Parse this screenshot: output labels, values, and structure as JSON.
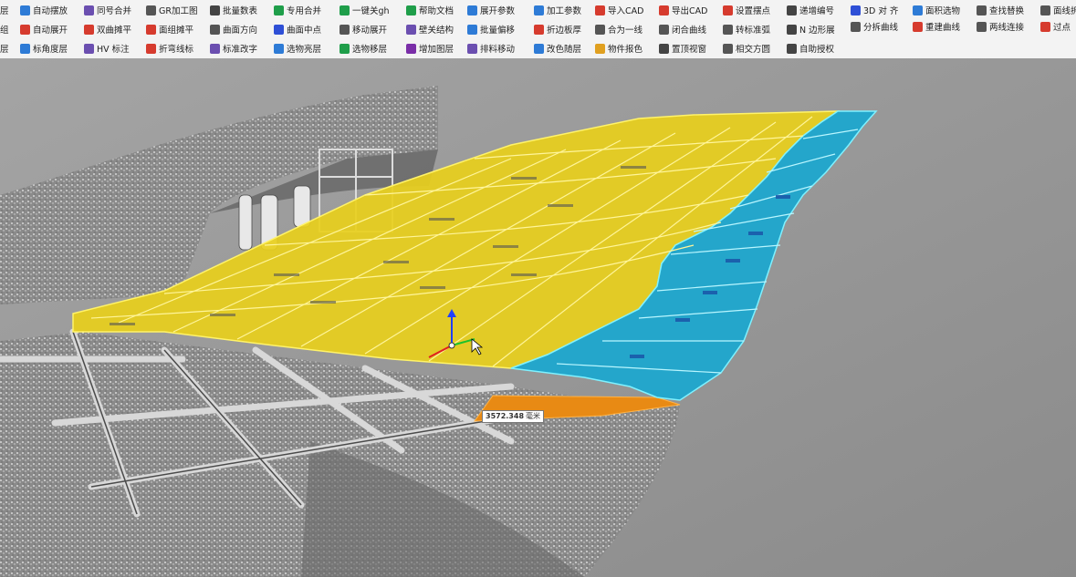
{
  "ribbon": {
    "columns": [
      {
        "items": [
          {
            "label": "自动摆放",
            "icon": "auto-place-icon",
            "color": "#2e7bd6"
          },
          {
            "label": "自动展开",
            "icon": "auto-unfold-icon",
            "color": "#d63b2e"
          },
          {
            "label": "标角度层",
            "icon": "angle-layer-icon",
            "color": "#2e7bd6"
          }
        ]
      },
      {
        "items": [
          {
            "label": "同号合并",
            "icon": "same-number-merge-icon",
            "color": "#6b4fb0"
          },
          {
            "label": "双曲摊平",
            "icon": "hyperbolic-flatten-icon",
            "color": "#d63b2e"
          },
          {
            "label": "HV 标注",
            "icon": "hv-annotate-icon",
            "color": "#6b4fb0"
          }
        ]
      },
      {
        "items": [
          {
            "label": "GR加工图",
            "icon": "gr-drawing-icon",
            "color": "#555555"
          },
          {
            "label": "面组摊平",
            "icon": "face-group-flatten-icon",
            "color": "#d63b2e"
          },
          {
            "label": "折弯线标",
            "icon": "bend-line-icon",
            "color": "#d63b2e"
          }
        ]
      },
      {
        "items": [
          {
            "label": "批量数表",
            "icon": "batch-table-icon",
            "color": "#444444"
          },
          {
            "label": "曲面方向",
            "icon": "surface-direction-icon",
            "color": "#555555"
          },
          {
            "label": "标准改字",
            "icon": "standard-text-icon",
            "color": "#6b4fb0"
          }
        ]
      },
      {
        "items": [
          {
            "label": "专用合并",
            "icon": "special-merge-icon",
            "color": "#1f9e4a"
          },
          {
            "label": "曲面中点",
            "icon": "surface-midpoint-icon",
            "color": "#2e4fd6"
          },
          {
            "label": "选物亮层",
            "icon": "highlight-layer-icon",
            "color": "#2e7bd6"
          }
        ]
      },
      {
        "items": [
          {
            "label": "一键关gh",
            "icon": "close-gh-icon",
            "color": "#1f9e4a"
          },
          {
            "label": "移动展开",
            "icon": "move-unfold-icon",
            "color": "#555555"
          },
          {
            "label": "选物移层",
            "icon": "move-layer-icon",
            "color": "#1f9e4a"
          }
        ]
      },
      {
        "items": [
          {
            "label": "帮助文档",
            "icon": "help-doc-icon",
            "color": "#1f9e4a"
          },
          {
            "label": "壁关结构",
            "icon": "wall-structure-icon",
            "color": "#6b4fb0"
          },
          {
            "label": "增加图层",
            "icon": "add-layer-icon",
            "color": "#7a2ea8"
          }
        ]
      },
      {
        "items": [
          {
            "label": "展开参数",
            "icon": "unfold-params-icon",
            "color": "#2e7bd6"
          },
          {
            "label": "批量偏移",
            "icon": "batch-offset-icon",
            "color": "#2e7bd6"
          },
          {
            "label": "排料移动",
            "icon": "nesting-move-icon",
            "color": "#6b4fb0"
          }
        ]
      },
      {
        "items": [
          {
            "label": "加工参数",
            "icon": "process-params-icon",
            "color": "#2e7bd6"
          },
          {
            "label": "折边板厚",
            "icon": "fold-thickness-icon",
            "color": "#d63b2e"
          },
          {
            "label": "改色随层",
            "icon": "color-by-layer-icon",
            "color": "#2e7bd6"
          }
        ]
      },
      {
        "items": [
          {
            "label": "导入CAD",
            "icon": "import-cad-icon",
            "color": "#d63b2e"
          },
          {
            "label": "合为一线",
            "icon": "join-line-icon",
            "color": "#555555"
          },
          {
            "label": "物件报色",
            "icon": "object-color-icon",
            "color": "#e0a020"
          }
        ]
      },
      {
        "items": [
          {
            "label": "导出CAD",
            "icon": "export-cad-icon",
            "color": "#d63b2e"
          },
          {
            "label": "闭合曲线",
            "icon": "close-curve-icon",
            "color": "#555555"
          },
          {
            "label": "置顶视窗",
            "icon": "top-viewport-icon",
            "color": "#444444"
          }
        ]
      },
      {
        "items": [
          {
            "label": "设置摆点",
            "icon": "set-point-icon",
            "color": "#d63b2e"
          },
          {
            "label": "转标准弧",
            "icon": "standard-arc-icon",
            "color": "#555555"
          },
          {
            "label": "相交方圆",
            "icon": "intersect-circle-icon",
            "color": "#555555"
          }
        ]
      },
      {
        "items": [
          {
            "label": "递增编号",
            "icon": "increment-number-icon",
            "color": "#444444"
          },
          {
            "label": "N 边形展",
            "icon": "n-gon-unfold-icon",
            "color": "#444444"
          },
          {
            "label": "自助授权",
            "icon": "self-license-icon",
            "color": "#444444"
          }
        ]
      },
      {
        "items": [
          {
            "label": "3D 对 齐",
            "icon": "align-3d-icon",
            "color": "#2e4fd6"
          },
          {
            "label": "分拆曲线",
            "icon": "split-curve-icon",
            "color": "#555555"
          }
        ]
      },
      {
        "items": [
          {
            "label": "面积选物",
            "icon": "area-select-icon",
            "color": "#2e7bd6"
          },
          {
            "label": "重建曲线",
            "icon": "rebuild-curve-icon",
            "color": "#d63b2e"
          }
        ]
      },
      {
        "items": [
          {
            "label": "查找替换",
            "icon": "find-replace-icon",
            "color": "#555555"
          },
          {
            "label": "两线连接",
            "icon": "connect-lines-icon",
            "color": "#555555"
          }
        ]
      },
      {
        "items": [
          {
            "label": "面线拆",
            "icon": "face-line-split-icon",
            "color": "#555555"
          },
          {
            "label": "过点",
            "icon": "through-point-icon",
            "color": "#d63b2e"
          }
        ]
      }
    ],
    "left_partial": [
      "层",
      "组",
      "层"
    ]
  },
  "viewport": {
    "coordinate_readout": "3572.348",
    "unit_suffix": "毫米",
    "colors": {
      "yellow_panels": "#e8cf1c",
      "blue_panels": "#1aa7cf",
      "orange_panel": "#e88a14",
      "background": "#8f8f8f"
    }
  }
}
